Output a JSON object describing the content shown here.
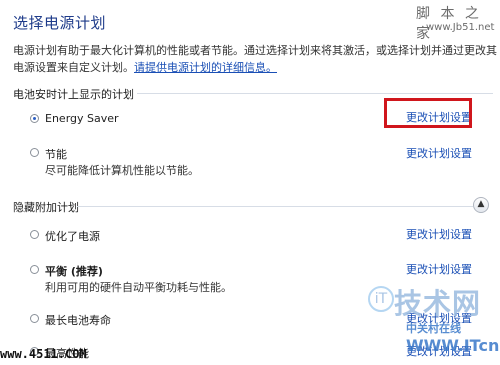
{
  "watermarks": {
    "top_text": "脚 本 之 家",
    "top_url": "www.Jb51.net",
    "bottom_text": "www.4511.COM",
    "logo_big": "技术网",
    "logo_prefix": "iT",
    "logo_small": "中关村在线",
    "logo_url": "WWW.ITcn"
  },
  "page": {
    "title": "选择电源计划",
    "intro_text": "电源计划有助于最大化计算机的性能或者节能。通过选择计划来将其激活，或选择计划并通过更改其电源设置来自定义计划。",
    "intro_link": "请提供电源计划的详细信息。"
  },
  "battery_section": {
    "header": "电池安时计上显示的计划",
    "plans": [
      {
        "name": "Energy Saver",
        "desc": "",
        "selected": true,
        "link": "更改计划设置"
      },
      {
        "name": "节能",
        "desc": "尽可能降低计算机性能以节能。",
        "selected": false,
        "link": "更改计划设置"
      }
    ]
  },
  "hidden_section": {
    "header": "隐藏附加计划",
    "plans": [
      {
        "name": "优化了电源",
        "desc": "",
        "selected": false,
        "link": "更改计划设置"
      },
      {
        "name": "平衡 (推荐)",
        "desc": "利用可用的硬件自动平衡功耗与性能。",
        "selected": false,
        "link": "更改计划设置"
      },
      {
        "name": "最长电池寿命",
        "desc": "",
        "selected": false,
        "link": "更改计划设置"
      },
      {
        "name": "最高性能",
        "desc": "",
        "selected": false,
        "link": "更改计划设置"
      }
    ]
  },
  "colors": {
    "highlight_box": "#d0161c",
    "link": "#1a4fb5",
    "title": "#1e3b8a"
  }
}
